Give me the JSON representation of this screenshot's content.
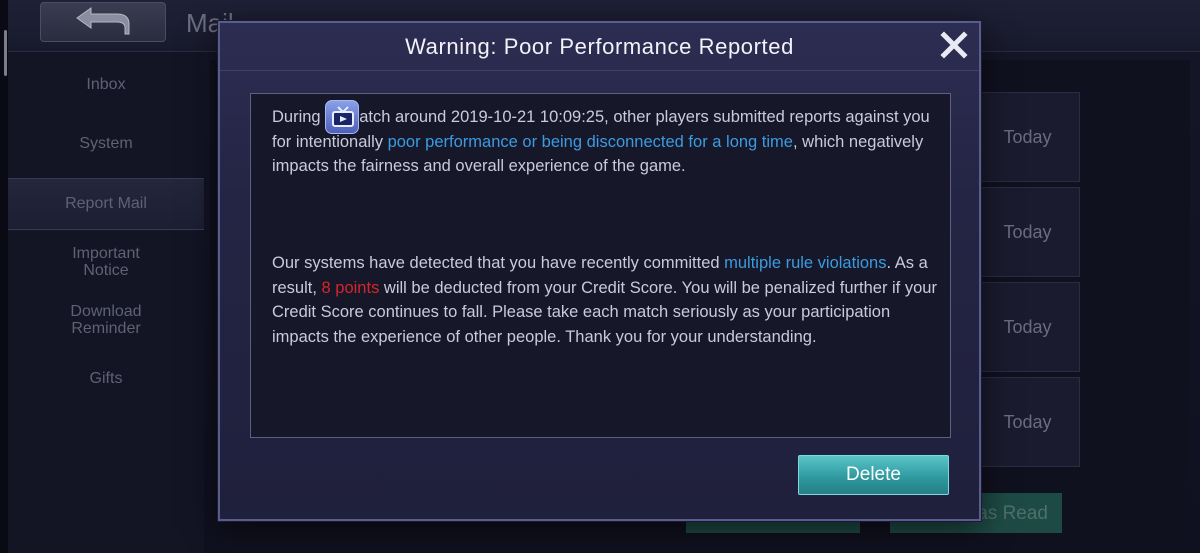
{
  "header": {
    "title": "Mail",
    "back_icon": "back-arrow-icon"
  },
  "sidebar": {
    "items": [
      {
        "label": "Inbox",
        "active": false
      },
      {
        "label": "System",
        "active": false
      },
      {
        "label": "Report Mail",
        "active": true
      },
      {
        "label": "Important Notice",
        "active": false
      },
      {
        "label": "Download Reminder",
        "active": false
      },
      {
        "label": "Gifts",
        "active": false
      }
    ]
  },
  "mail_list": {
    "items": [
      {
        "date": "Today"
      },
      {
        "date": "Today"
      },
      {
        "date": "Today"
      },
      {
        "date": "Today"
      }
    ],
    "mark_read_label": "as Read"
  },
  "dialog": {
    "title": "Warning: Poor Performance Reported",
    "close_icon": "close-x-icon",
    "match_icon": "tv-replay-icon",
    "paragraph1": {
      "part1": "During ",
      "part2": "atch around 2019-10-21 10:09:25, other players submitted reports against you for intentionally ",
      "highlight": "poor performance or being disconnected for a long time",
      "part3": ", which negatively impacts the fairness and overall experience of the game."
    },
    "paragraph2": {
      "part1": "Our systems have detected that you have recently committed ",
      "highlight": "multiple rule violations",
      "part2": ". As a result, ",
      "points": "8 points",
      "part3": " will be deducted from your Credit Score. You will be penalized further if your Credit Score continues to fall. Please take each match seriously as your participation impacts the experience of other people. Thank you for your understanding."
    },
    "delete_label": "Delete"
  },
  "colors": {
    "highlight_blue": "#3c9be0",
    "highlight_red": "#d3262a",
    "delete_button": "#3aa7ac",
    "dialog_border": "#5a5c8e"
  }
}
